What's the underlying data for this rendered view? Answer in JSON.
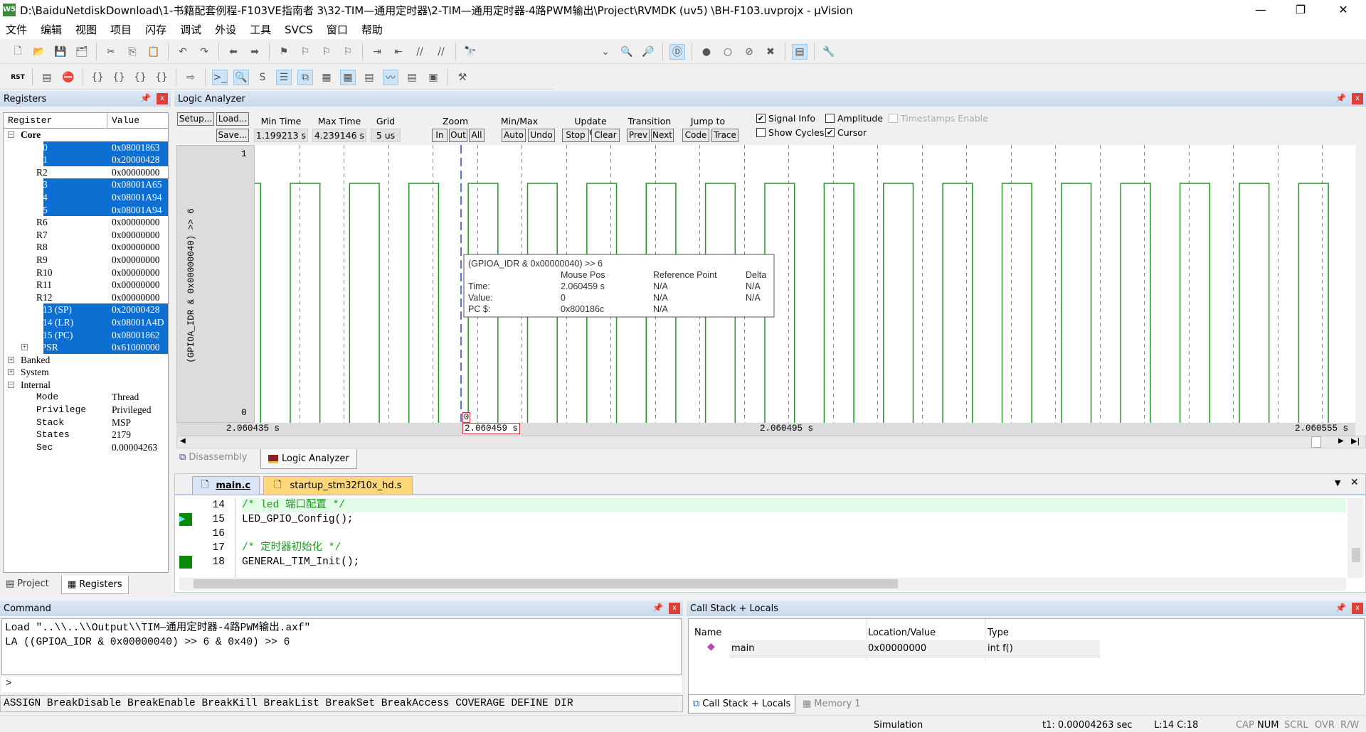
{
  "window": {
    "title": "D:\\BaiduNetdiskDownload\\1-书籍配套例程-F103VE指南者 3\\32-TIM—通用定时器\\2-TIM—通用定时器-4路PWM输出\\Project\\RVMDK  (uv5)  \\BH-F103.uvprojx - µVision",
    "icon_text": "W5",
    "minimize": "—",
    "restore": "❐",
    "close": "✕"
  },
  "menu": [
    "文件",
    "编辑",
    "视图",
    "项目",
    "闪存",
    "调试",
    "外设",
    "工具",
    "SVCS",
    "窗口",
    "帮助"
  ],
  "toolbar1": [
    "new-file",
    "open-folder",
    "save",
    "save-all",
    "|",
    "cut",
    "copy",
    "paste",
    "|",
    "undo",
    "redo",
    "|",
    "nav-back",
    "nav-forward",
    "|",
    "bookmark",
    "prev-bookmark",
    "next-bookmark",
    "clear-bookmarks",
    "|",
    "indent",
    "unindent",
    "comment",
    "uncomment",
    "|",
    "find-in-files"
  ],
  "toolbar1_right": [
    "dropdown",
    "find",
    "incremental-find",
    "|",
    "debug-session",
    "|",
    "breakpoint",
    "disable-breakpoint",
    "disable-all-breakpoints",
    "kill-all-breakpoints",
    "|",
    "window-layout",
    "|",
    "configure"
  ],
  "toolbar2": [
    "reset",
    "|",
    "run-to-cursor",
    "stop",
    "|",
    "step-into",
    "step-over",
    "step-out",
    "run-to-cursor-line",
    "|",
    "show-next-statement",
    "|",
    "command-window",
    "disassembly-window",
    "symbols-window",
    "registers-window",
    "call-stack-window",
    "watch-windows",
    "memory-windows",
    "serial-windows",
    "analysis-windows",
    "trace-windows",
    "system-viewer",
    "|",
    "toolbox"
  ],
  "registers": {
    "title": "Registers",
    "col_register": "Register",
    "col_value": "Value",
    "groups": [
      {
        "label": "Core",
        "expanded": true
      },
      {
        "label": "Banked",
        "expanded": false
      },
      {
        "label": "System",
        "expanded": false
      },
      {
        "label": "Internal",
        "expanded": true
      }
    ],
    "core": [
      {
        "name": "R0",
        "value": "0x08001863",
        "changed": true
      },
      {
        "name": "R1",
        "value": "0x20000428",
        "changed": true
      },
      {
        "name": "R2",
        "value": "0x00000000",
        "changed": false
      },
      {
        "name": "R3",
        "value": "0x08001A65",
        "changed": true
      },
      {
        "name": "R4",
        "value": "0x08001A94",
        "changed": true
      },
      {
        "name": "R5",
        "value": "0x08001A94",
        "changed": true
      },
      {
        "name": "R6",
        "value": "0x00000000",
        "changed": false
      },
      {
        "name": "R7",
        "value": "0x00000000",
        "changed": false
      },
      {
        "name": "R8",
        "value": "0x00000000",
        "changed": false
      },
      {
        "name": "R9",
        "value": "0x00000000",
        "changed": false
      },
      {
        "name": "R10",
        "value": "0x00000000",
        "changed": false
      },
      {
        "name": "R11",
        "value": "0x00000000",
        "changed": false
      },
      {
        "name": "R12",
        "value": "0x00000000",
        "changed": false
      },
      {
        "name": "R13 (SP)",
        "value": "0x20000428",
        "changed": true
      },
      {
        "name": "R14 (LR)",
        "value": "0x08001A4D",
        "changed": true
      },
      {
        "name": "R15 (PC)",
        "value": "0x08001862",
        "changed": true
      },
      {
        "name": "xPSR",
        "value": "0x61000000",
        "changed": true
      }
    ],
    "internal": [
      {
        "name": "Mode",
        "value": "Thread"
      },
      {
        "name": "Privilege",
        "value": "Privileged"
      },
      {
        "name": "Stack",
        "value": "MSP"
      },
      {
        "name": "States",
        "value": "2179"
      },
      {
        "name": "Sec",
        "value": "0.00004263"
      }
    ],
    "tabs": [
      "Project",
      "Registers"
    ]
  },
  "logic": {
    "title": "Logic Analyzer",
    "buttons": {
      "setup": "Setup...",
      "load": "Load...",
      "save": "Save...",
      "in": "In",
      "out": "Out",
      "all": "All",
      "auto": "Auto",
      "undo": "Undo",
      "stop": "Stop",
      "clear": "Clear",
      "prev": "Prev",
      "next": "Next",
      "code": "Code",
      "trace": "Trace"
    },
    "labels": {
      "min_time": "Min Time",
      "max_time": "Max Time",
      "grid": "Grid",
      "zoom": "Zoom",
      "minmax": "Min/Max",
      "update": "Update Screen",
      "transition": "Transition",
      "jump": "Jump to"
    },
    "values": {
      "min_time": "1.199213 s",
      "max_time": "4.239146 s",
      "grid": "5 us"
    },
    "checks": [
      {
        "label": "Signal Info",
        "checked": true,
        "disabled": false
      },
      {
        "label": "Amplitude",
        "checked": false,
        "disabled": false
      },
      {
        "label": "Timestamps Enable",
        "checked": false,
        "disabled": true
      },
      {
        "label": "Show Cycles",
        "checked": false,
        "disabled": false
      },
      {
        "label": "Cursor",
        "checked": true,
        "disabled": false
      }
    ],
    "signal_name": "(GPIOA_IDR & 0x00000040) >> 6",
    "y_max": "1",
    "y_min": "0",
    "time_labels": [
      "2.060435 s",
      "2.060495 s",
      "2.060555 s"
    ],
    "cursor_time": "2.060459 s",
    "cursor_value": "0",
    "waveform": {
      "view_start_s": 2.060435,
      "view_end_s": 2.060559,
      "grid_us": 5,
      "first_rise_s": 2.060439,
      "period_us": 6.67,
      "duty": 0.5,
      "color": "#1f9a1f"
    },
    "tooltip": {
      "title": "(GPIOA_IDR & 0x00000040) >> 6",
      "col_mouse": "Mouse Pos",
      "col_ref": "Reference Point",
      "col_delta": "Delta",
      "rows": [
        {
          "label": "Time:",
          "mouse": "2.060459 s",
          "ref": "N/A",
          "delta": "N/A"
        },
        {
          "label": "Value:",
          "mouse": "0",
          "ref": "N/A",
          "delta": "N/A"
        },
        {
          "label": "PC $:",
          "mouse": "0x800186c",
          "ref": "N/A",
          "delta": ""
        }
      ]
    },
    "tabs": [
      "Disassembly",
      "Logic Analyzer"
    ]
  },
  "editor": {
    "tabs": [
      "main.c",
      "startup_stm32f10x_hd.s"
    ],
    "lines": [
      {
        "n": "14",
        "text": "/* led 端口配置 */",
        "comment": true,
        "current": true,
        "marker": ""
      },
      {
        "n": "15",
        "text": "LED_GPIO_Config();",
        "comment": false,
        "current": false,
        "marker": "arrow"
      },
      {
        "n": "16",
        "text": "",
        "comment": false,
        "current": false,
        "marker": ""
      },
      {
        "n": "17",
        "text": "/* 定时器初始化 */",
        "comment": true,
        "current": false,
        "marker": ""
      },
      {
        "n": "18",
        "text": "GENERAL_TIM_Init();",
        "comment": false,
        "current": false,
        "marker": "block"
      }
    ]
  },
  "command": {
    "title": "Command",
    "output": [
      "Load \"..\\\\..\\\\Output\\\\TIM—通用定时器-4路PWM输出.axf\"",
      "LA ((GPIOA_IDR & 0x00000040) >> 6 & 0x40) >> 6"
    ],
    "prompt": ">",
    "hints": "ASSIGN BreakDisable BreakEnable BreakKill BreakList BreakSet BreakAccess COVERAGE DEFINE DIR"
  },
  "callstack": {
    "title": "Call Stack + Locals",
    "cols": [
      "Name",
      "Location/Value",
      "Type"
    ],
    "rows": [
      {
        "name": "main",
        "value": "0x00000000",
        "type": "int f()"
      }
    ],
    "tabs": [
      "Call Stack + Locals",
      "Memory 1"
    ]
  },
  "status": {
    "mode": "Simulation",
    "time": "t1: 0.00004263 sec",
    "pos": "L:14 C:18",
    "keys": [
      "CAP",
      "NUM",
      "SCRL",
      "OVR",
      "R/W"
    ]
  }
}
